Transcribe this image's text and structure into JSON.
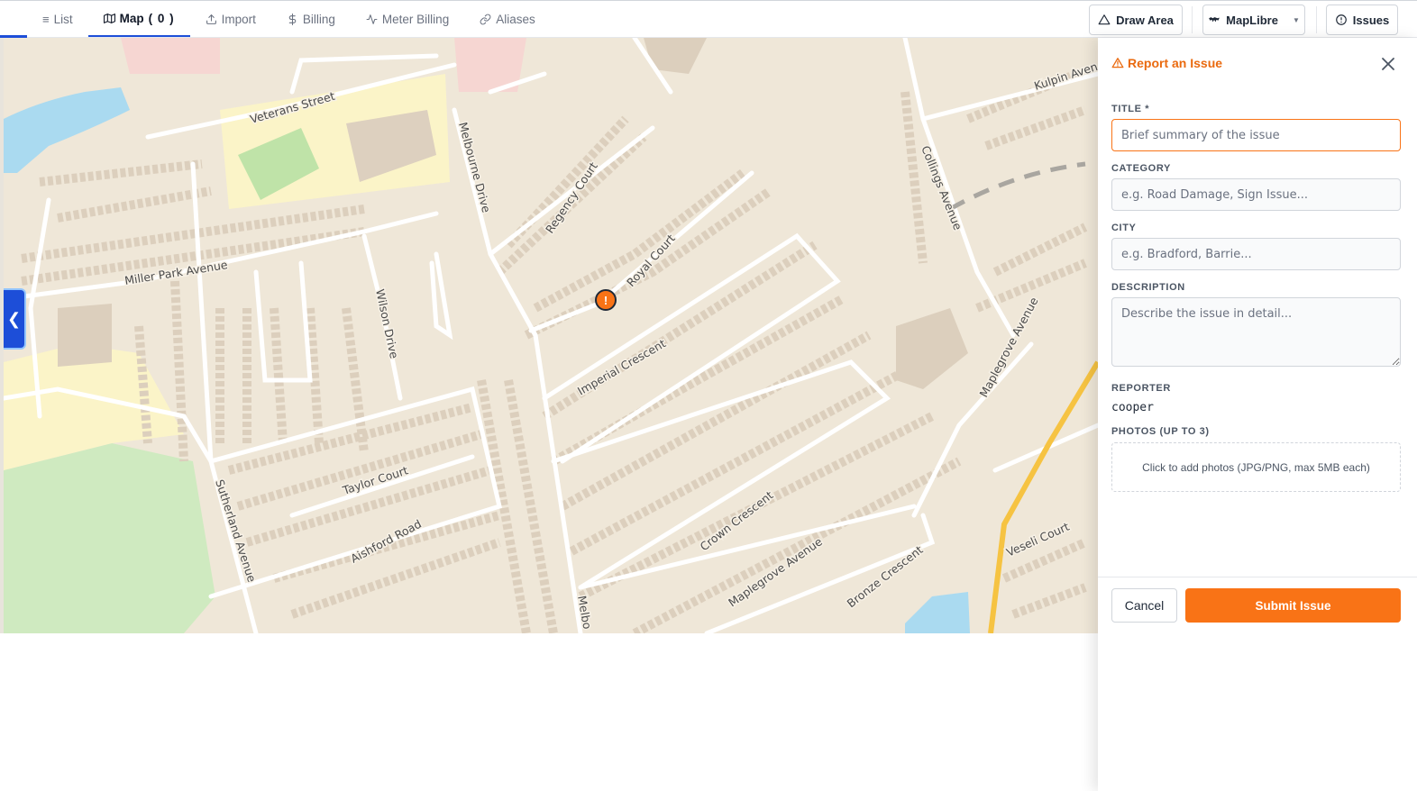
{
  "tabs": [
    {
      "label": "List",
      "icon": "list-icon"
    },
    {
      "label": "Map",
      "count": "( 0 )",
      "icon": "map-icon"
    },
    {
      "label": "Import",
      "icon": "upload-icon"
    },
    {
      "label": "Billing",
      "icon": "dollar-icon"
    },
    {
      "label": "Meter Billing",
      "icon": "activity-icon"
    },
    {
      "label": "Aliases",
      "icon": "link-icon"
    }
  ],
  "toolbar": {
    "draw_area": "Draw Area",
    "map_engine": "MapLibre",
    "issues": "Issues"
  },
  "map": {
    "collapse_glyph": "❮",
    "marker_glyph": "!",
    "streets": [
      "Veterans Street",
      "Melbourne Drive",
      "Regency Court",
      "Royal Court",
      "Miller Park Avenue",
      "Wilson Drive",
      "Imperial Crescent",
      "Collings Avenue",
      "Kulpin Aven",
      "Maplegrove Avenue",
      "Taylor Court",
      "Sutherland Avenue",
      "Aishford Road",
      "Crown Crescent",
      "Maplegrove Avenue",
      "Bronze Crescent",
      "Veseli Court",
      "Melbo"
    ],
    "colors": {
      "land": "#efe7d8",
      "water": "#aadaf0",
      "park": "#cfeac0",
      "school": "#fbf4c8",
      "building": "#e0d4c4",
      "road": "#ffffff",
      "highway": "#f6c342"
    }
  },
  "panel": {
    "title": "Report an Issue",
    "fields": {
      "title_label": "TITLE *",
      "title_placeholder": "Brief summary of the issue",
      "category_label": "CATEGORY",
      "category_placeholder": "e.g. Road Damage, Sign Issue...",
      "city_label": "CITY",
      "city_placeholder": "e.g. Bradford, Barrie...",
      "description_label": "DESCRIPTION",
      "description_placeholder": "Describe the issue in detail...",
      "reporter_label": "REPORTER",
      "reporter_value": "cooper",
      "photos_label": "PHOTOS (UP TO 3)",
      "photos_hint": "Click to add photos (JPG/PNG, max 5MB each)"
    },
    "cancel_label": "Cancel",
    "submit_label": "Submit Issue",
    "accent_color": "#f97316"
  }
}
